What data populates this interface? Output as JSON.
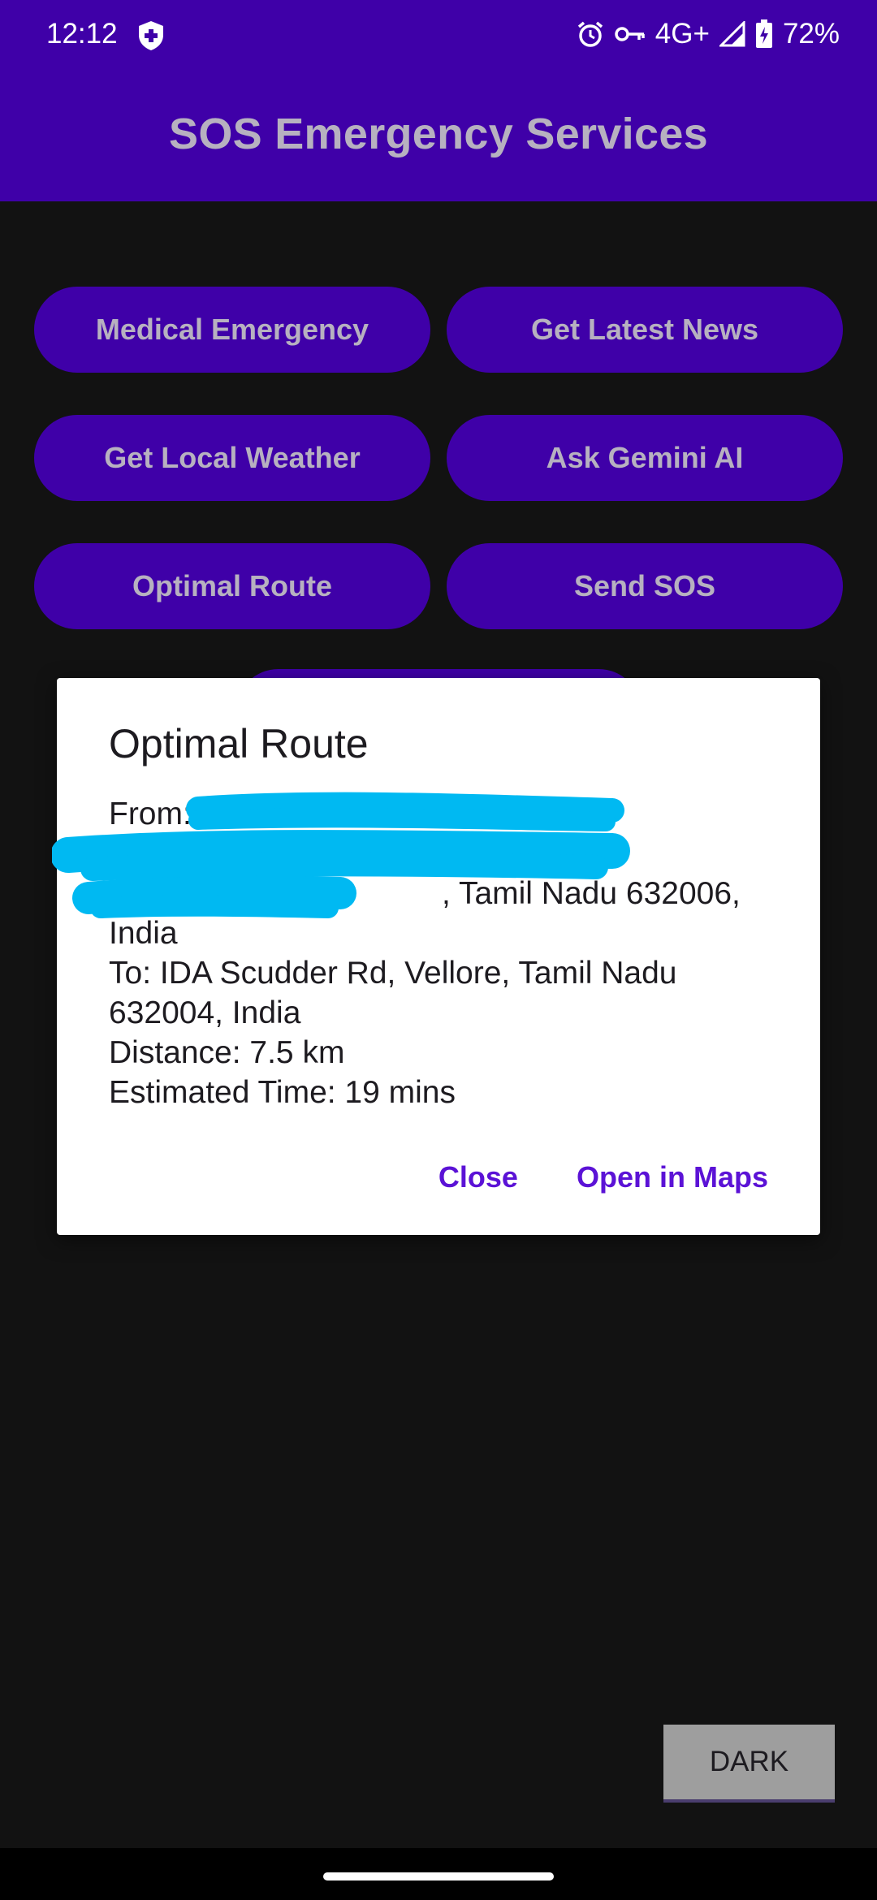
{
  "status_bar": {
    "time": "12:12",
    "network": "4G+",
    "battery": "72%",
    "icons": [
      "shield-icon",
      "alarm-icon",
      "vpn-key-icon",
      "signal-icon",
      "battery-charging-icon"
    ]
  },
  "app_bar": {
    "title": "SOS Emergency Services"
  },
  "buttons": {
    "medical": "Medical Emergency",
    "news": "Get Latest News",
    "weather": "Get Local Weather",
    "gemini": "Ask Gemini AI",
    "route": "Optimal Route",
    "sos": "Send SOS"
  },
  "dialog": {
    "title": "Optimal Route",
    "from_prefix": "From: X",
    "from_line3_suffix": ", Tamil Nadu 632006,",
    "from_line4": "India",
    "to": "To: IDA Scudder Rd, Vellore, Tamil Nadu 632004, India",
    "distance": "Distance: 7.5 km",
    "estimated_time": "Estimated Time: 19 mins",
    "close_label": "Close",
    "open_maps_label": "Open in Maps"
  },
  "theme_toggle": {
    "label": "DARK"
  },
  "colors": {
    "primary": "#3f00a8",
    "button_text": "#b7b1c0",
    "dialog_action": "#5b12d6",
    "redaction": "#00b9f2",
    "background": "#121212"
  }
}
